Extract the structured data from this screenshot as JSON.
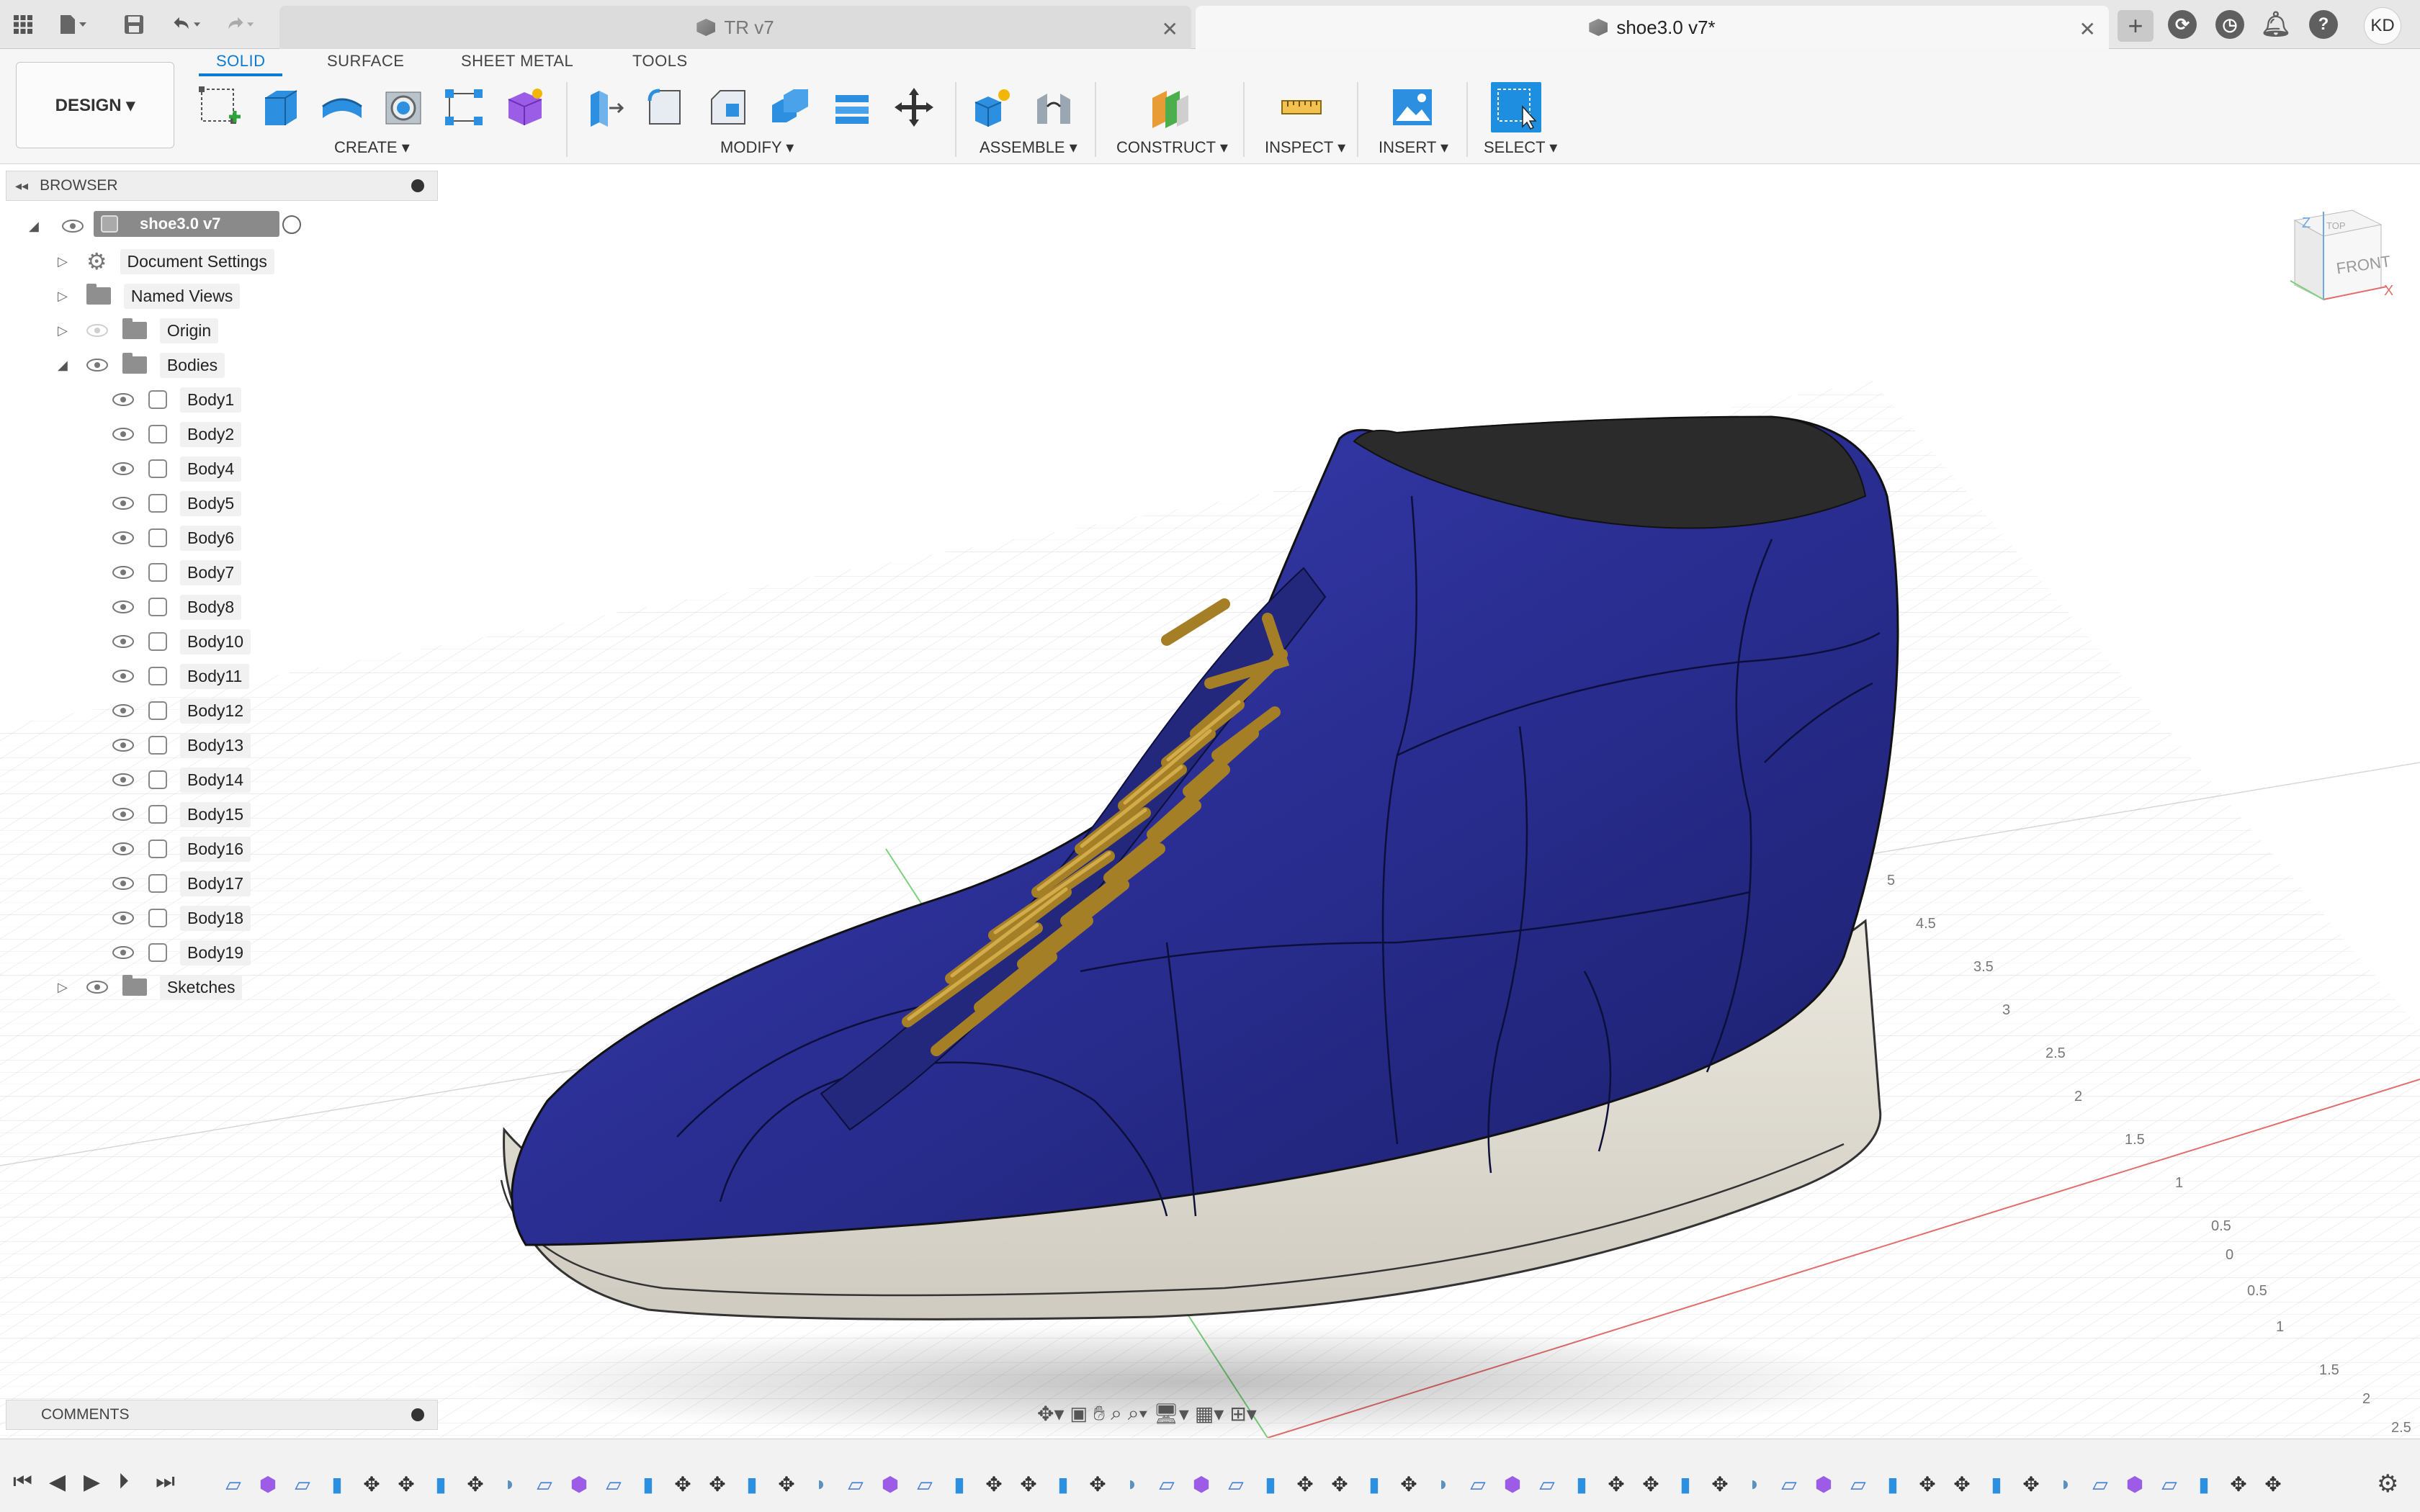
{
  "titlebar": {
    "tabs": [
      {
        "label": "TR v7",
        "active": false
      },
      {
        "label": "shoe3.0 v7*",
        "active": true
      }
    ],
    "user_initials": "KD"
  },
  "workspace": {
    "label": "DESIGN ▾"
  },
  "ribbon": {
    "tabs": [
      "SOLID",
      "SURFACE",
      "SHEET METAL",
      "TOOLS"
    ],
    "active_tab": "SOLID",
    "groups": [
      "CREATE ▾",
      "MODIFY ▾",
      "ASSEMBLE ▾",
      "CONSTRUCT ▾",
      "INSPECT ▾",
      "INSERT ▾",
      "SELECT ▾"
    ]
  },
  "browser": {
    "title": "BROWSER",
    "root": "shoe3.0 v7",
    "document_settings": "Document Settings",
    "named_views": "Named Views",
    "origin": "Origin",
    "bodies_folder": "Bodies",
    "bodies": [
      "Body1",
      "Body2",
      "Body4",
      "Body5",
      "Body6",
      "Body7",
      "Body8",
      "Body10",
      "Body11",
      "Body12",
      "Body13",
      "Body14",
      "Body15",
      "Body16",
      "Body17",
      "Body18",
      "Body19"
    ],
    "sketches": "Sketches"
  },
  "comments": {
    "title": "COMMENTS"
  },
  "viewcube": {
    "face_label": "FRONT",
    "top_label": "TOP",
    "axis_x": "X",
    "axis_z": "Z"
  },
  "grid_labels": [
    "5",
    "4.5",
    "3.5",
    "3",
    "2.5",
    "2",
    "1.5",
    "1",
    "0.5",
    "0",
    "0.5",
    "1",
    "1.5",
    "2",
    "2.5"
  ],
  "colors": {
    "accent": "#0d7bd4",
    "shoe_upper": "#2a2e92",
    "laces": "#b08a2a",
    "sole": "#dedad0",
    "collar": "#2b2b2b"
  }
}
